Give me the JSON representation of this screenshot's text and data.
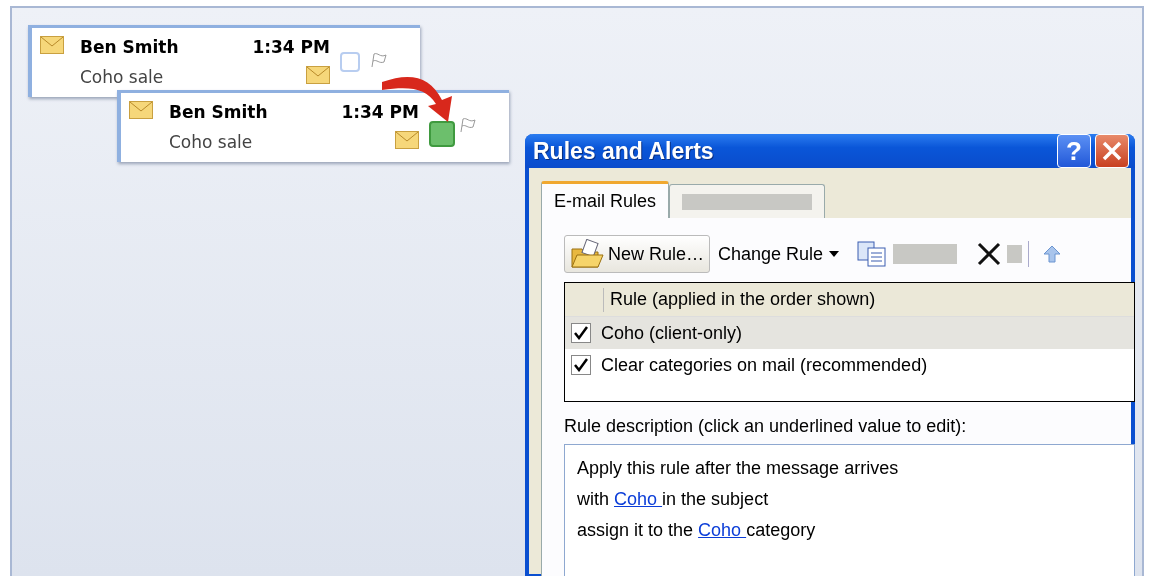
{
  "messages": [
    {
      "sender": "Ben Smith",
      "time": "1:34 PM",
      "subject": "Coho sale",
      "categorized": false
    },
    {
      "sender": "Ben Smith",
      "time": "1:34 PM",
      "subject": "Coho sale",
      "categorized": true,
      "color": "#6cbf6c"
    }
  ],
  "dialog": {
    "title": "Rules and Alerts",
    "help": "?",
    "tabs": [
      {
        "label": "E-mail Rules",
        "selected": true
      },
      {
        "selected": false
      }
    ],
    "toolbar": {
      "new_rule": "New Rule…",
      "change_rule": "Change Rule"
    },
    "list": {
      "column": "Rule (applied in the order shown)",
      "rows": [
        {
          "name": "Coho (client-only)",
          "checked": true,
          "selected": true
        },
        {
          "name": "Clear categories on mail (recommended)",
          "checked": true,
          "selected": false
        }
      ]
    },
    "description_label": "Rule description (click an underlined value to edit):",
    "description": [
      [
        {
          "text": "Apply this rule after the message arrives",
          "link": false
        }
      ],
      [
        {
          "text": "with ",
          "link": false
        },
        {
          "text": "Coho ",
          "link": true
        },
        {
          "text": "in the subject",
          "link": false
        }
      ],
      [
        {
          "text": "assign it to the ",
          "link": false
        },
        {
          "text": "Coho ",
          "link": true
        },
        {
          "text": "category",
          "link": false
        }
      ]
    ]
  }
}
